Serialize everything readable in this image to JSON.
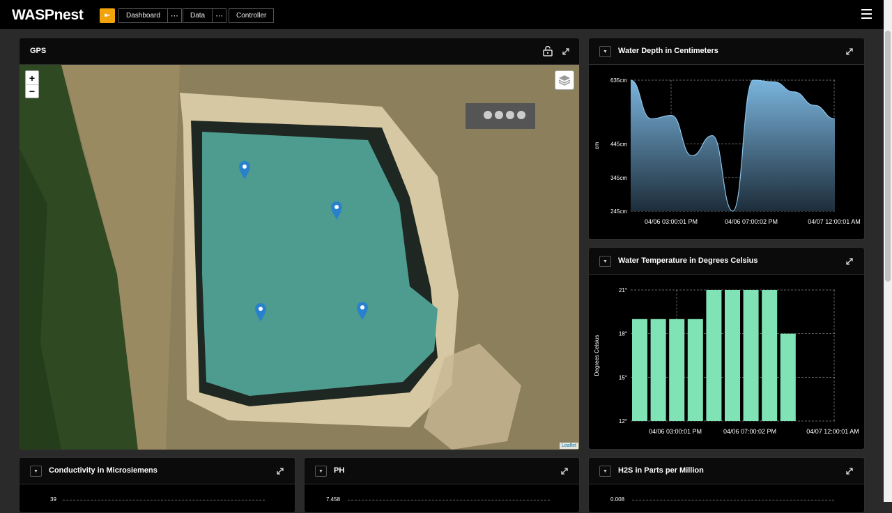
{
  "app": {
    "title": "WASPnest"
  },
  "nav": {
    "dashboard_label": "Dashboard",
    "data_label": "Data",
    "controller_label": "Controller",
    "more_glyph": "⋯"
  },
  "colors": {
    "accent": "#f0a30a",
    "depth_fill": "#7ab4dd",
    "temp_bar": "#7fe3b6"
  },
  "gps": {
    "title": "GPS",
    "zoom_in": "+",
    "zoom_out": "−",
    "attribution": "Leaflet",
    "marker_count": 4
  },
  "panels": {
    "depth_title": "Water Depth in Centimeters",
    "temp_title": "Water Temperature in Degrees Celsius",
    "cond_title": "Conductivity in Microsiemens",
    "ph_title": "PH",
    "h2s_title": "H2S in Parts per Million",
    "cond_first_tick": "39",
    "ph_first_tick": "7.458",
    "h2s_first_tick": "0.008"
  },
  "chart_data": [
    {
      "type": "area",
      "title": "Water Depth in Centimeters",
      "ylabel": "cm",
      "ylim": [
        245,
        635
      ],
      "yticks": [
        "635cm",
        "445cm",
        "345cm",
        "245cm"
      ],
      "ytick_values": [
        635,
        445,
        345,
        245
      ],
      "xticks": [
        "04/06 03:00:01 PM",
        "04/06 07:00:02 PM",
        "04/07 12:00:01 AM"
      ],
      "x": [
        0,
        0.1,
        0.2,
        0.3,
        0.4,
        0.5,
        0.6,
        0.7,
        0.8,
        0.9,
        1.0
      ],
      "values": [
        635,
        520,
        530,
        410,
        470,
        245,
        635,
        630,
        600,
        560,
        520
      ],
      "grid": true
    },
    {
      "type": "bar",
      "title": "Water Temperature in Degrees Celsius",
      "ylabel": "Degrees Celsius",
      "ylim": [
        12,
        21
      ],
      "yticks": [
        "21°",
        "18°",
        "15°",
        "12°"
      ],
      "ytick_values": [
        21,
        18,
        15,
        12
      ],
      "xticks": [
        "04/06 03:00:01 PM",
        "04/06 07:00:02 PM",
        "04/07 12:00:01 AM"
      ],
      "values": [
        19,
        19,
        19,
        19,
        21,
        21,
        21,
        21,
        18
      ],
      "grid": true
    }
  ]
}
